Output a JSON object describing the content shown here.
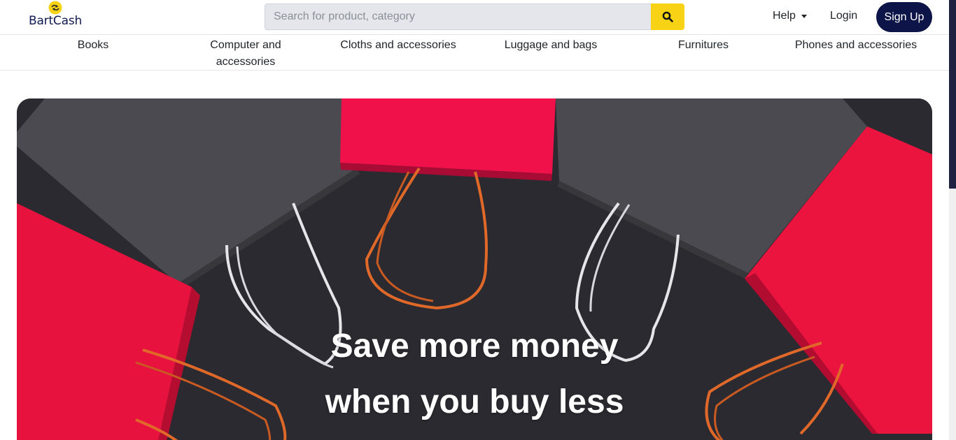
{
  "brand": {
    "name": "BartCash",
    "accent": "#f7d215",
    "navy": "#0d1447"
  },
  "search": {
    "placeholder": "Search for product, category",
    "value": "",
    "button_icon": "search-icon"
  },
  "header": {
    "help_label": "Help",
    "login_label": "Login",
    "signup_label": "Sign Up"
  },
  "categories": [
    {
      "label_line1": "Books",
      "label_line2": ""
    },
    {
      "label_line1": "Computer and",
      "label_line2": "accessories"
    },
    {
      "label_line1": "Cloths and accessories",
      "label_line2": ""
    },
    {
      "label_line1": "Luggage and bags",
      "label_line2": ""
    },
    {
      "label_line1": "Furnitures",
      "label_line2": ""
    },
    {
      "label_line1": "Phones and accessories",
      "label_line2": ""
    }
  ],
  "hero": {
    "line1": "Save more money",
    "line2": "when you buy less"
  }
}
